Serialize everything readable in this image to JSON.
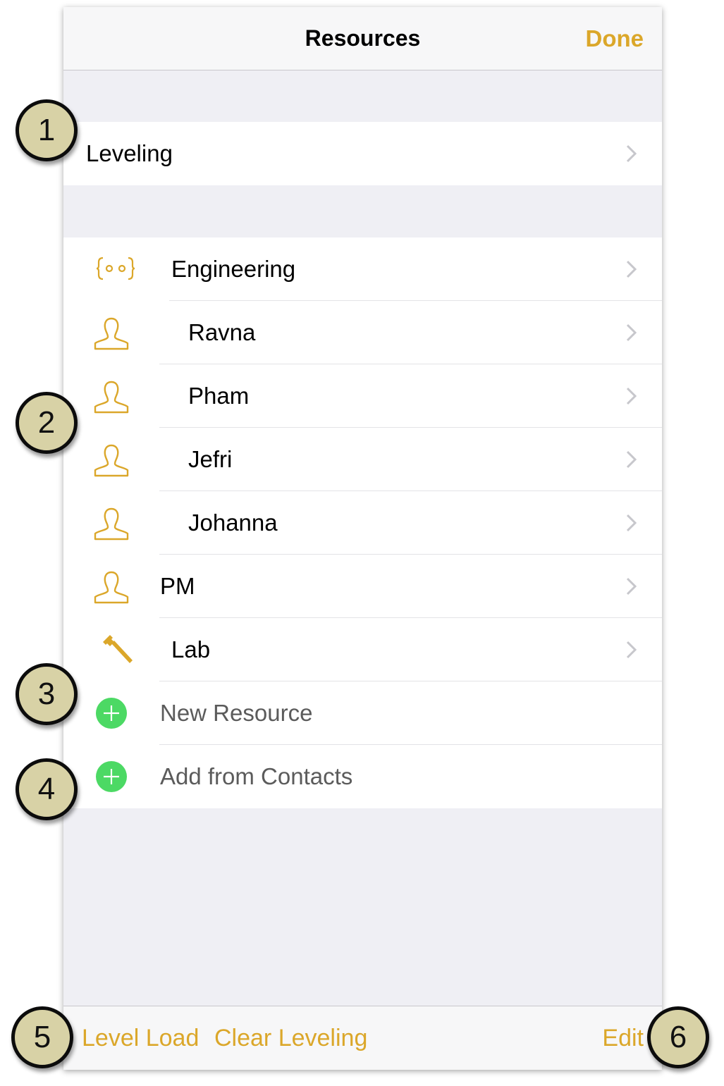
{
  "navbar": {
    "title": "Resources",
    "done_label": "Done"
  },
  "leveling": {
    "label": "Leveling"
  },
  "resources": [
    {
      "label": "Engineering",
      "icon": "group-icon",
      "indent": 0
    },
    {
      "label": "Ravna",
      "icon": "person-icon",
      "indent": 1
    },
    {
      "label": "Pham",
      "icon": "person-icon",
      "indent": 1
    },
    {
      "label": "Jefri",
      "icon": "person-icon",
      "indent": 1
    },
    {
      "label": "Johanna",
      "icon": "person-icon",
      "indent": 1
    },
    {
      "label": "PM",
      "icon": "person-icon",
      "indent": 0
    },
    {
      "label": "Lab",
      "icon": "hammer-icon",
      "indent": 0
    }
  ],
  "actions": [
    {
      "label": "New Resource",
      "icon": "add-icon"
    },
    {
      "label": "Add from Contacts",
      "icon": "add-icon"
    }
  ],
  "toolbar": {
    "level_load": "Level Load",
    "clear_leveling": "Clear Leveling",
    "edit": "Edit"
  },
  "callouts": [
    "1",
    "2",
    "3",
    "4",
    "5",
    "6"
  ],
  "colors": {
    "accent": "#dba72a",
    "add_green": "#4cd964",
    "background": "#efeff4"
  }
}
